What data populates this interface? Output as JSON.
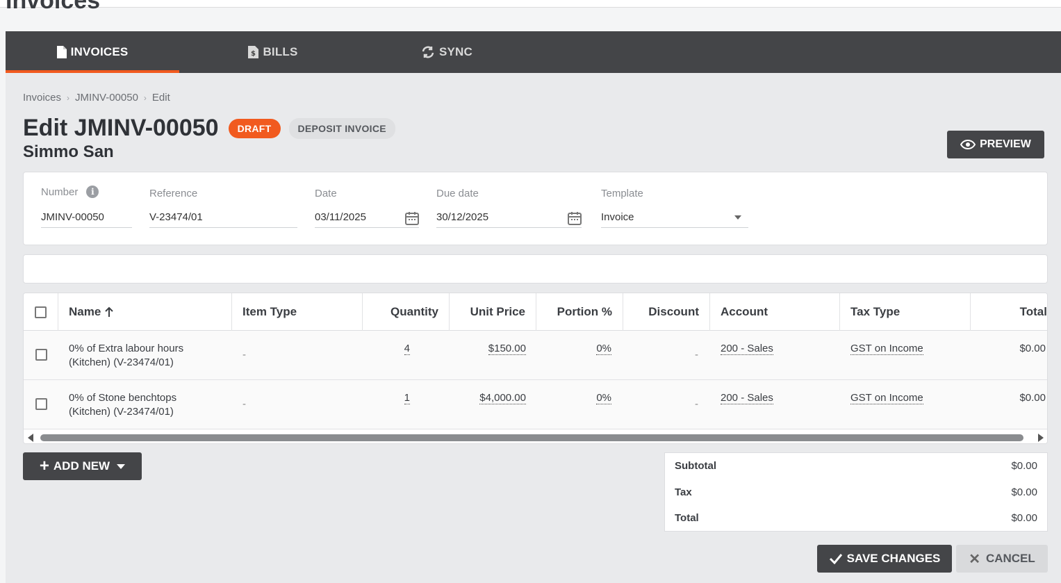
{
  "page_heading": "Invoices",
  "nav": {
    "tabs": [
      {
        "label": "INVOICES",
        "icon": "file-icon",
        "active": true
      },
      {
        "label": "BILLS",
        "icon": "bill-icon",
        "active": false
      },
      {
        "label": "SYNC",
        "icon": "sync-icon",
        "active": false
      }
    ],
    "accent_color": "#f15a1f"
  },
  "breadcrumb": [
    "Invoices",
    "JMINV-00050",
    "Edit"
  ],
  "header": {
    "title": "Edit JMINV-00050",
    "status_badge": "DRAFT",
    "type_badge": "DEPOSIT INVOICE",
    "customer": "Simmo San",
    "preview_label": "PREVIEW"
  },
  "form": {
    "number": {
      "label": "Number",
      "value": "JMINV-00050"
    },
    "reference": {
      "label": "Reference",
      "value": "V-23474/01"
    },
    "date": {
      "label": "Date",
      "value": "03/11/2025"
    },
    "due_date": {
      "label": "Due date",
      "value": "30/12/2025"
    },
    "template": {
      "label": "Template",
      "value": "Invoice"
    }
  },
  "table": {
    "columns": [
      "Name",
      "Item Type",
      "Quantity",
      "Unit Price",
      "Portion %",
      "Discount",
      "Account",
      "Tax Type",
      "Total"
    ],
    "rows": [
      {
        "name_line1": "0% of Extra labour hours",
        "name_line2": "(Kitchen) (V-23474/01)",
        "item_type": "-",
        "quantity": "4",
        "unit_price": "$150.00",
        "portion": "0%",
        "discount": "-",
        "account": "200 - Sales",
        "tax_type": "GST on Income",
        "total": "$0.00"
      },
      {
        "name_line1": "0% of Stone benchtops",
        "name_line2": "(Kitchen) (V-23474/01)",
        "item_type": "-",
        "quantity": "1",
        "unit_price": "$4,000.00",
        "portion": "0%",
        "discount": "-",
        "account": "200 - Sales",
        "tax_type": "GST on Income",
        "total": "$0.00"
      }
    ]
  },
  "add_new_label": "ADD NEW",
  "totals": {
    "subtotal_label": "Subtotal",
    "subtotal": "$0.00",
    "tax_label": "Tax",
    "tax": "$0.00",
    "total_label": "Total",
    "total": "$0.00"
  },
  "actions": {
    "save_label": "SAVE CHANGES",
    "cancel_label": "CANCEL"
  }
}
